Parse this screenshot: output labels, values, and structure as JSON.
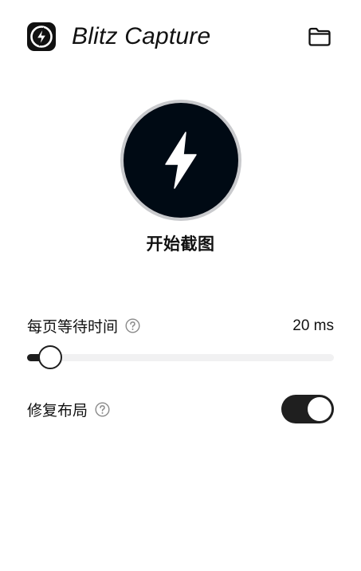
{
  "header": {
    "title": "Blitz Capture",
    "logo_icon": "lightning-bolt-logo-icon",
    "folder_icon": "folder-icon"
  },
  "capture": {
    "label": "开始截图",
    "icon": "lightning-bolt-icon",
    "colors": {
      "ring": "#c9cacd",
      "fill": "#000a14"
    }
  },
  "settings": {
    "page_wait": {
      "label": "每页等待时间",
      "help_icon": "question-circle-icon",
      "value_text": "20 ms",
      "slider_fraction": 0.075
    },
    "fix_layout": {
      "label": "修复布局",
      "help_icon": "question-circle-icon",
      "enabled": true
    }
  }
}
